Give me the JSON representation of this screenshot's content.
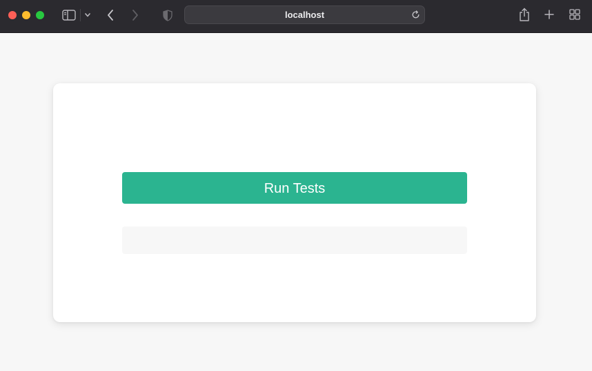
{
  "browser": {
    "address": "localhost",
    "colors": {
      "titlebar": "#2b2a2f",
      "close": "#fe5f57",
      "minimize": "#febc2e",
      "maximize": "#28c840"
    },
    "icons": [
      "sidebar-icon",
      "chevron-down-icon",
      "back-icon",
      "forward-icon",
      "shield-icon",
      "reload-icon",
      "share-icon",
      "plus-icon",
      "tab-overview-icon"
    ]
  },
  "page": {
    "run_button_label": "Run Tests",
    "results_text": "",
    "colors": {
      "accent": "#2bb490",
      "background": "#f7f7f7",
      "card": "#ffffff"
    }
  }
}
